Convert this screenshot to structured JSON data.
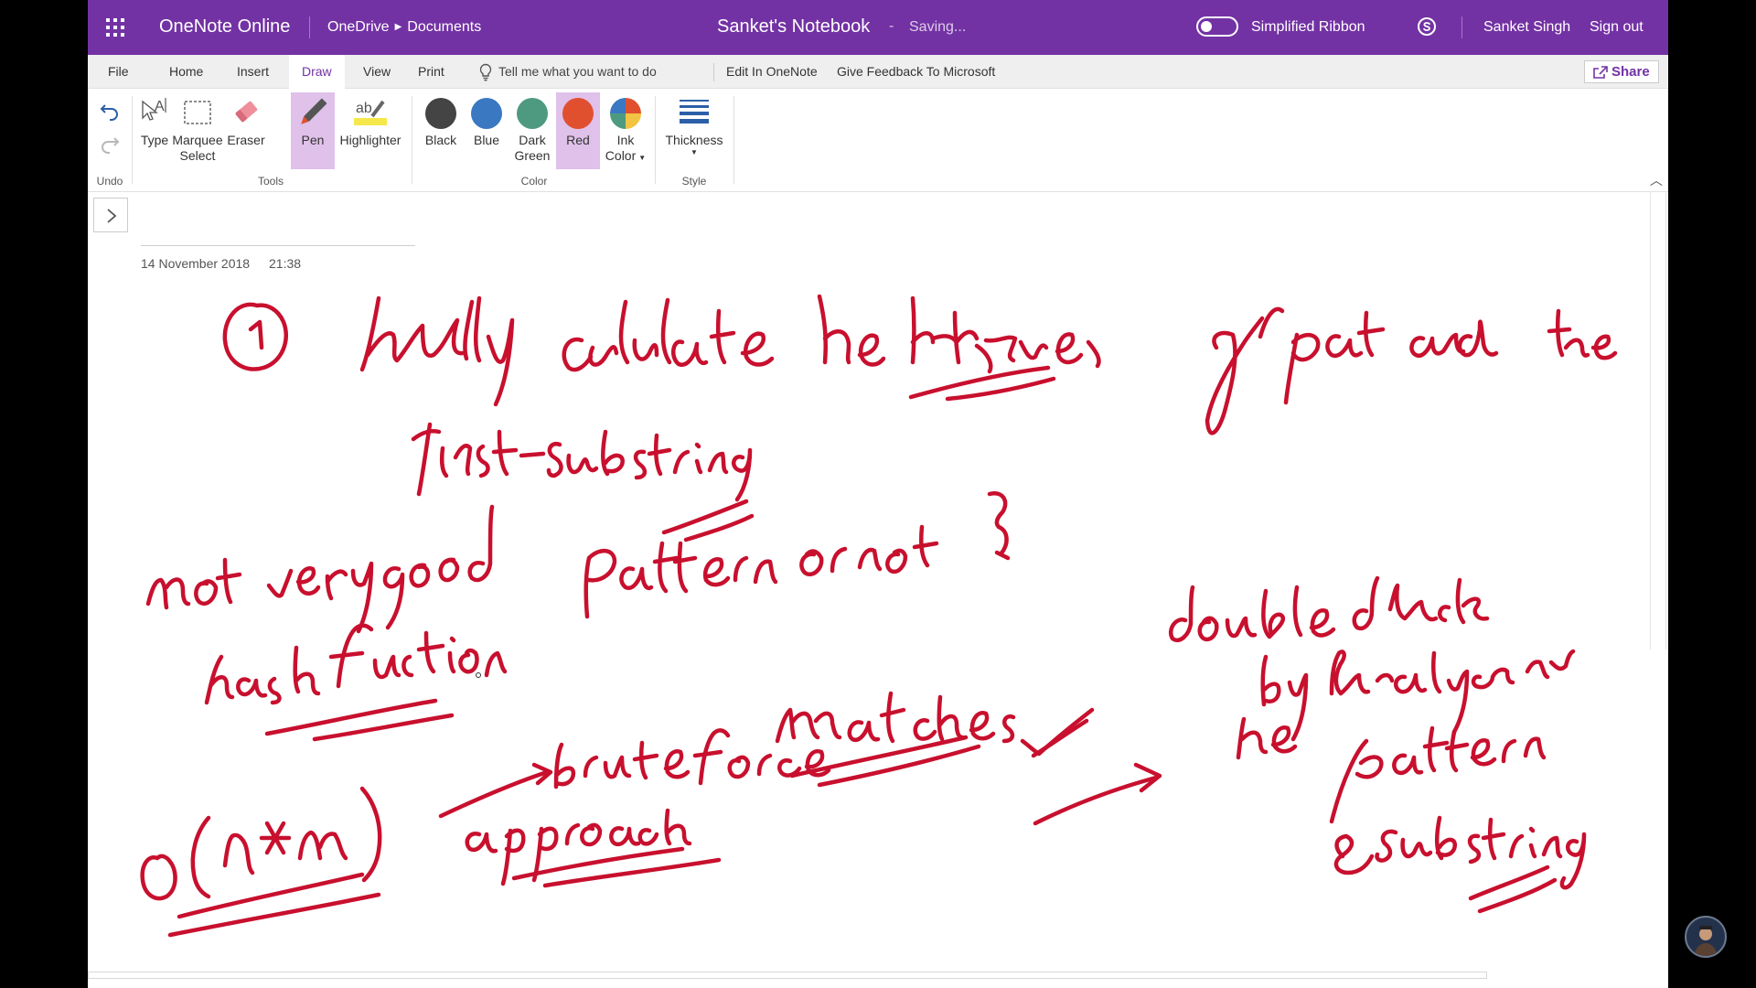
{
  "titlebar": {
    "app_name": "OneNote Online",
    "breadcrumb_onedrive": "OneDrive",
    "breadcrumb_documents": "Documents",
    "notebook_title": "Sanket's Notebook",
    "separator": "-",
    "status": "Saving...",
    "simplified_ribbon_label": "Simplified Ribbon",
    "user_name": "Sanket Singh",
    "sign_out": "Sign out"
  },
  "tabs": {
    "file": "File",
    "home": "Home",
    "insert": "Insert",
    "draw": "Draw",
    "view": "View",
    "print": "Print",
    "tell_me": "Tell me what you want to do",
    "edit_in_onenote": "Edit In OneNote",
    "feedback": "Give Feedback To Microsoft",
    "share": "Share"
  },
  "ribbon": {
    "undo_group": "Undo",
    "tools_group": "Tools",
    "color_group": "Color",
    "style_group": "Style",
    "type": "Type",
    "marquee_1": "Marquee",
    "marquee_2": "Select",
    "eraser": "Eraser",
    "pen": "Pen",
    "highlighter": "Highlighter",
    "black": "Black",
    "blue": "Blue",
    "dark_green_1": "Dark",
    "dark_green_2": "Green",
    "red": "Red",
    "ink_color_1": "Ink",
    "ink_color_2": "Color",
    "thickness": "Thickness",
    "selected_tool": "Pen",
    "selected_color": "Red"
  },
  "colors": {
    "brand": "#7332a4",
    "selection": "#dfc1ea",
    "black_swatch": "#444444",
    "blue_swatch": "#3a78c2",
    "dark_green_swatch": "#4e9a80",
    "red_swatch": "#e0502f",
    "ink": "#c8102e"
  },
  "page": {
    "date": "14 November 2018",
    "time": "21:38"
  },
  "icons": {
    "apps": "waffle-icon",
    "skype": "skype-icon",
    "share": "share-icon",
    "lightbulb": "lightbulb-icon",
    "undo": "undo-icon",
    "redo": "redo-icon",
    "expand": "chevron-right-icon"
  }
}
